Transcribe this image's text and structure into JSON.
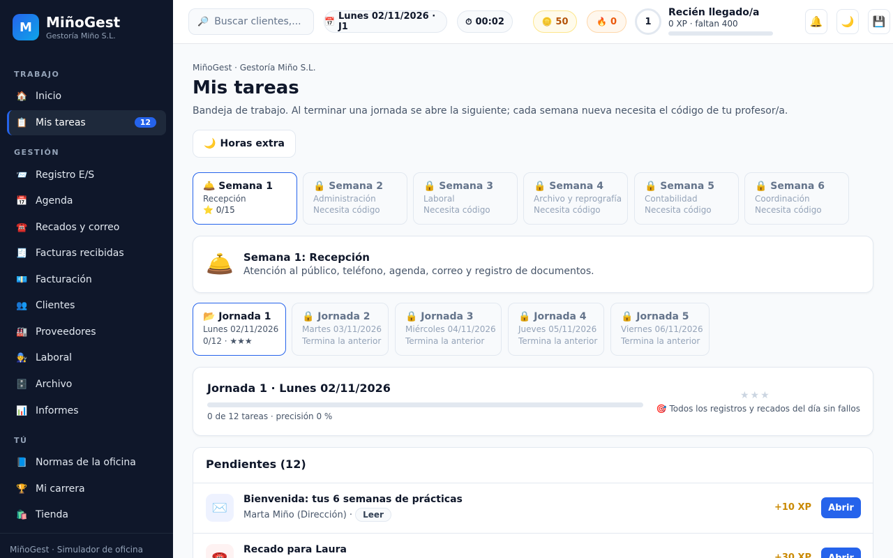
{
  "brand": {
    "logo": "M",
    "name": "MiñoGest",
    "subtitle": "Gestoría Miño S.L."
  },
  "sidebar": {
    "sections": [
      {
        "label": "TRABAJO"
      },
      {
        "label": "GESTIÓN"
      },
      {
        "label": "TÚ"
      }
    ],
    "items": [
      {
        "icon": "🏠",
        "label": "Inicio"
      },
      {
        "icon": "📋",
        "label": "Mis tareas",
        "badge": "12"
      },
      {
        "icon": "📨",
        "label": "Registro E/S"
      },
      {
        "icon": "📅",
        "label": "Agenda"
      },
      {
        "icon": "☎️",
        "label": "Recados y correo"
      },
      {
        "icon": "🧾",
        "label": "Facturas recibidas"
      },
      {
        "icon": "💶",
        "label": "Facturación"
      },
      {
        "icon": "👥",
        "label": "Clientes"
      },
      {
        "icon": "🏭",
        "label": "Proveedores"
      },
      {
        "icon": "🧑‍🔧",
        "label": "Laboral"
      },
      {
        "icon": "🗄️",
        "label": "Archivo"
      },
      {
        "icon": "📊",
        "label": "Informes"
      },
      {
        "icon": "📘",
        "label": "Normas de la oficina"
      },
      {
        "icon": "🏆",
        "label": "Mi carrera"
      },
      {
        "icon": "🛍️",
        "label": "Tienda"
      }
    ],
    "footer": "MiñoGest · Simulador de oficina"
  },
  "topbar": {
    "search_placeholder": "Buscar clientes,...",
    "date_icon": "📅",
    "date": "Lunes 02/11/2026 · J1",
    "timer_icon": "⏱",
    "timer": "00:02",
    "coins_icon": "🪙",
    "coins": "50",
    "streak_icon": "🔥",
    "streak": "0",
    "level": "1",
    "level_title": "Recién llegado/a",
    "level_xp": "0 XP · faltan 400",
    "level_progress": 0,
    "bell_icon": "🔔",
    "theme_icon": "🌙",
    "save_icon": "💾"
  },
  "main": {
    "breadcrumb": "MiñoGest · Gestoría Miño S.L.",
    "title": "Mis tareas",
    "description": "Bandeja de trabajo. Al terminar una jornada se abre la siguiente; cada semana nueva necesita el código de tu profesor/a.",
    "extra_button": {
      "icon": "🌙",
      "label": "Horas extra"
    },
    "weeks": [
      {
        "title": "🛎️ Semana 1",
        "area": "Recepción",
        "status": "⭐ 0/15",
        "active": true
      },
      {
        "title": "🔒 Semana 2",
        "area": "Administración",
        "status": "Necesita código"
      },
      {
        "title": "🔒 Semana 3",
        "area": "Laboral",
        "status": "Necesita código"
      },
      {
        "title": "🔒 Semana 4",
        "area": "Archivo y reprografía",
        "status": "Necesita código"
      },
      {
        "title": "🔒 Semana 5",
        "area": "Contabilidad",
        "status": "Necesita código"
      },
      {
        "title": "🔒 Semana 6",
        "area": "Coordinación",
        "status": "Necesita código"
      }
    ],
    "week_banner": {
      "icon": "🛎️",
      "title": "Semana 1: Recepción",
      "description": "Atención al público, teléfono, agenda, correo y registro de documentos."
    },
    "days": [
      {
        "title": "📂 Jornada 1",
        "date": "Lunes 02/11/2026",
        "status": "0/12 · ★★★",
        "active": true
      },
      {
        "title": "🔒 Jornada 2",
        "date": "Martes 03/11/2026",
        "status": "Termina la anterior"
      },
      {
        "title": "🔒 Jornada 3",
        "date": "Miércoles 04/11/2026",
        "status": "Termina la anterior"
      },
      {
        "title": "🔒 Jornada 4",
        "date": "Jueves 05/11/2026",
        "status": "Termina la anterior"
      },
      {
        "title": "🔒 Jornada 5",
        "date": "Viernes 06/11/2026",
        "status": "Termina la anterior"
      }
    ],
    "day_panel": {
      "title": "Jornada 1 · Lunes 02/11/2026",
      "progress": 0,
      "stats": "0 de 12 tareas · precisión 0 %",
      "stars": "★★★",
      "goal": "🎯 Todos los registros y recados del día sin fallos"
    },
    "pending": {
      "heading": "Pendientes (12)",
      "tasks": [
        {
          "icon": "✉️",
          "title": "Bienvenida: tus 6 semanas de prácticas",
          "meta": "Marta Miño (Dirección) ·",
          "tag": "Leer",
          "xp": "+10 XP",
          "action": "Abrir"
        },
        {
          "icon": "☎️",
          "title": "Recado para Laura",
          "meta": "",
          "tag": "",
          "xp": "+30 XP",
          "action": "Abrir"
        }
      ]
    }
  },
  "colors": {
    "accent": "#2563eb",
    "sidebar_bg": "#0f172a",
    "xp_gold": "#ca8a04"
  }
}
